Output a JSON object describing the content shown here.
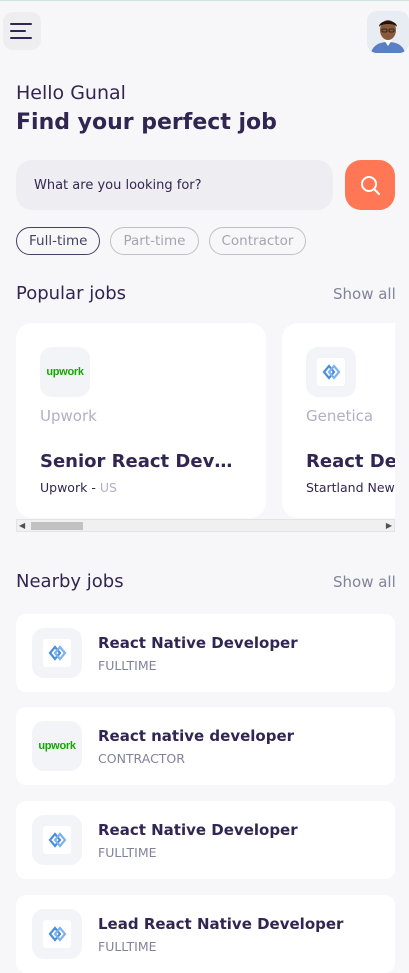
{
  "header": {
    "menu_icon": "hamburger-menu-icon",
    "avatar_icon": "user-avatar"
  },
  "welcome": {
    "greeting": "Hello Gunal",
    "headline": "Find your perfect job"
  },
  "search": {
    "placeholder": "What are you looking for?",
    "button_icon": "search-icon"
  },
  "job_types": [
    {
      "label": "Full-time",
      "active": true
    },
    {
      "label": "Part-time",
      "active": false
    },
    {
      "label": "Contractor",
      "active": false
    }
  ],
  "popular": {
    "title": "Popular jobs",
    "show_all": "Show all",
    "jobs": [
      {
        "company": "Upwork",
        "title": "Senior React Developer",
        "employer": "Upwork",
        "country": "US",
        "logo": "upwork",
        "logo_text": "upwork"
      },
      {
        "company": "Genetica",
        "title": "React Developer",
        "employer": "Startland New",
        "country": "",
        "logo": "genetica"
      }
    ],
    "separator": " - "
  },
  "nearby": {
    "title": "Nearby jobs",
    "show_all": "Show all",
    "jobs": [
      {
        "title": "React Native Developer",
        "type": "FULLTIME",
        "logo": "genetica"
      },
      {
        "title": "React native developer",
        "type": "CONTRACTOR",
        "logo": "upwork",
        "logo_text": "upwork"
      },
      {
        "title": "React Native Developer",
        "type": "FULLTIME",
        "logo": "genetica"
      },
      {
        "title": "Lead React Native Developer",
        "type": "FULLTIME",
        "logo": "genetica"
      }
    ]
  },
  "colors": {
    "background": "#f7f7fa",
    "primary_text": "#312651",
    "accent": "#ff7754",
    "muted": "#83829a"
  }
}
